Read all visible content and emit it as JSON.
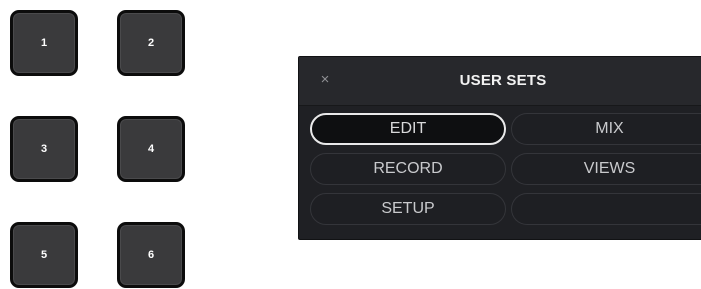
{
  "keys": [
    {
      "label": "1"
    },
    {
      "label": "2"
    },
    {
      "label": "3"
    },
    {
      "label": "4"
    },
    {
      "label": "5"
    },
    {
      "label": "6"
    }
  ],
  "panel": {
    "title": "USER SETS",
    "close_icon": "×",
    "selected": "EDIT",
    "buttons": [
      {
        "label": "EDIT"
      },
      {
        "label": "MIX"
      },
      {
        "label": "RECORD"
      },
      {
        "label": "VIEWS"
      },
      {
        "label": "SETUP"
      },
      {
        "label": ""
      }
    ]
  },
  "colors": {
    "key_face": "#3a3a3c",
    "key_border": "#0c0c0c",
    "panel_bg": "#1f2024",
    "selected_outline": "#e9e9ea",
    "text": "#c9cacd"
  }
}
